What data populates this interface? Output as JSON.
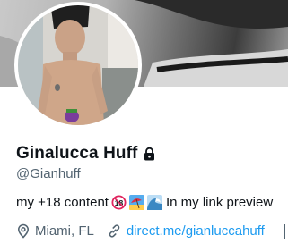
{
  "profile": {
    "display_name": "Ginalucca Huff",
    "handle": "@Gianhuff",
    "bio_text": "my +18 content",
    "bio_tail": "In my link preview",
    "bio_emoji_icons": [
      "no-under-18-icon",
      "beach-umbrella-icon",
      "water-wave-icon"
    ],
    "location": "Miami, FL",
    "website": "direct.me/gianluccahuff",
    "lock_icon": "lock-icon",
    "location_icon": "map-pin-icon",
    "link_icon": "link-icon"
  },
  "colors": {
    "text_primary": "#0f1419",
    "text_secondary": "#536471",
    "link": "#1d9bf0",
    "emoji_red": "#e0245e",
    "emoji_blue": "#3b88c3"
  }
}
